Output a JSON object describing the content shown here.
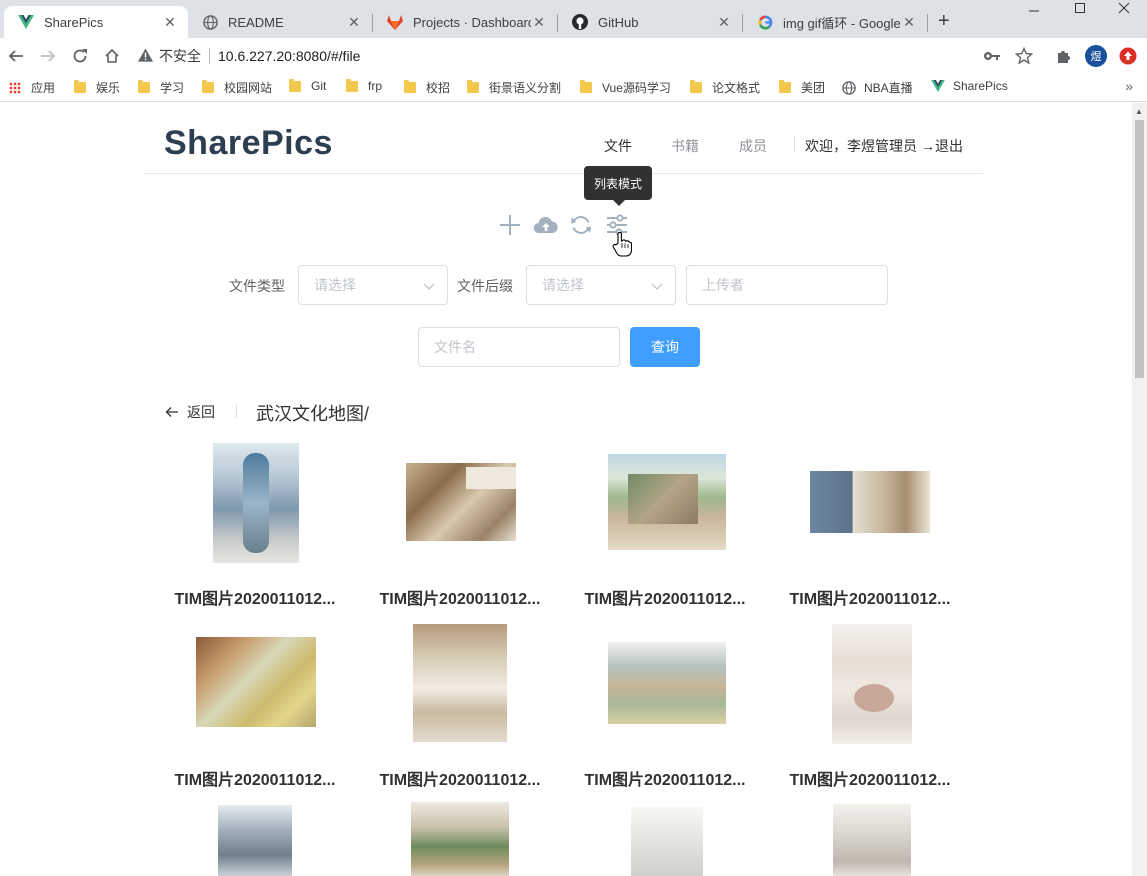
{
  "browser": {
    "tabs": [
      {
        "title": "SharePics",
        "icon": "vue-icon"
      },
      {
        "title": "README",
        "icon": "globe-icon"
      },
      {
        "title": "Projects · Dashboard",
        "icon": "gitlab-icon"
      },
      {
        "title": "GitHub",
        "icon": "github-icon"
      },
      {
        "title": "img gif循环 - Google",
        "icon": "google-icon"
      }
    ],
    "close_glyph": "✕",
    "new_tab_glyph": "+",
    "insecure_label": "不安全",
    "url": "10.6.227.20:8080/#/file",
    "profile_initial": "煜",
    "bookmarks": [
      "应用",
      "娱乐",
      "学习",
      "校园网站",
      "Git",
      "frp",
      "校招",
      "街景语义分割",
      "Vue源码学习",
      "论文格式",
      "美团",
      "NBA直播",
      "SharePics"
    ],
    "more_glyph": "»"
  },
  "header": {
    "logo": "SharePics",
    "nav": [
      "文件",
      "书籍",
      "成员"
    ],
    "welcome": "欢迎，李煜管理员",
    "logout": "→退出"
  },
  "toolbar": {
    "tooltip": "列表模式",
    "icons": [
      "plus-icon",
      "upload-cloud-icon",
      "refresh-icon",
      "sliders-icon"
    ]
  },
  "filters": {
    "type_label": "文件类型",
    "type_placeholder": "请选择",
    "suffix_label": "文件后缀",
    "suffix_placeholder": "请选择",
    "uploader_placeholder": "上传者",
    "filename_placeholder": "文件名",
    "query_button": "查询"
  },
  "nav_back": {
    "back_label": "返回",
    "path": "武汉文化地图/"
  },
  "files": [
    {
      "name": "TIM图片2020011012..."
    },
    {
      "name": "TIM图片2020011012..."
    },
    {
      "name": "TIM图片2020011012..."
    },
    {
      "name": "TIM图片2020011012..."
    },
    {
      "name": "TIM图片2020011012..."
    },
    {
      "name": "TIM图片2020011012..."
    },
    {
      "name": "TIM图片2020011012..."
    },
    {
      "name": "TIM图片2020011012..."
    },
    {
      "name": ""
    },
    {
      "name": ""
    },
    {
      "name": ""
    },
    {
      "name": ""
    }
  ],
  "colors": {
    "primary": "#409eff",
    "logo": "#2c3e50",
    "text": "#303133",
    "muted": "#909399",
    "border": "#dcdfe6",
    "placeholder": "#c0c4cc",
    "tooltip_bg": "#303133"
  }
}
